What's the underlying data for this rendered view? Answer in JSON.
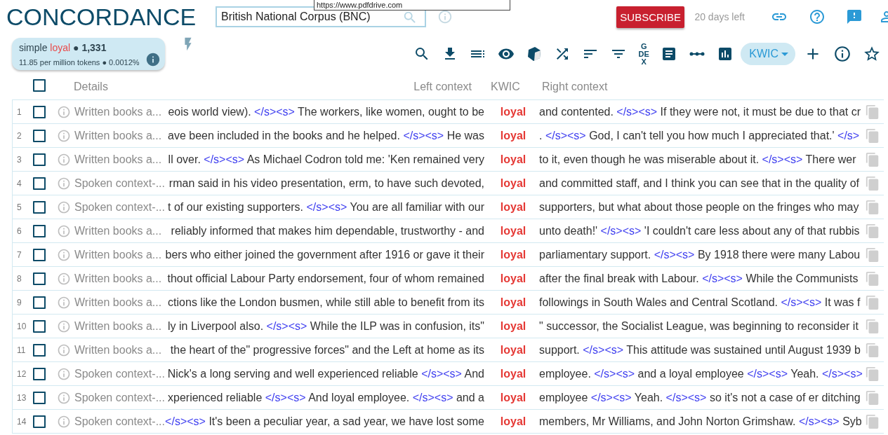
{
  "app": {
    "title": "CONCORDANCE",
    "corpus": "British National Corpus (BNC)",
    "subscribe": "SUBSCRIBE",
    "trial": "20 days left"
  },
  "tooltip": {
    "text": "https://www.pdfdrive.com"
  },
  "summary": {
    "line1": [
      {
        "kind": "text",
        "text": "simple "
      },
      {
        "kind": "query",
        "text": "loyal"
      },
      {
        "kind": "text",
        "text": " ● "
      },
      {
        "kind": "count",
        "text": "1,331"
      }
    ],
    "line2": "11.85 per million tokens ● 0.0012%"
  },
  "toolbar": {
    "gdex": "GDEX",
    "view_mode": "KWIC"
  },
  "table": {
    "select_all_checked": false,
    "columns": [
      "Details",
      "Left context",
      "KWIC",
      "Right context"
    ],
    "rows": [
      {
        "number": "1",
        "checked": false,
        "details": "Written books a...",
        "left": [
          {
            "text": "eois world view). ",
            "tag": "</s><s>"
          },
          {
            "text": " The workers, like women, ought to be"
          }
        ],
        "kwic": "loyal",
        "right": [
          {
            "text": "and contented. ",
            "tag": "</s><s>"
          },
          {
            "text": " If they were not, it must be due to that cr"
          }
        ]
      },
      {
        "number": "2",
        "checked": false,
        "details": "Written books a...",
        "left": [
          {
            "text": "ave been included in the books and he helped. ",
            "tag": "</s><s>"
          },
          {
            "text": " He was"
          }
        ],
        "kwic": "loyal",
        "right": [
          {
            "text": ". ",
            "tag": "</s><s>"
          },
          {
            "text": " God, I can't tell you how much I appreciated that.' ",
            "tag": "</s>"
          }
        ]
      },
      {
        "number": "3",
        "checked": false,
        "details": "Written books a...",
        "left": [
          {
            "text": "ll over. ",
            "tag": "</s><s>"
          },
          {
            "text": " As Michael Codron told me: 'Ken remained very"
          }
        ],
        "kwic": "loyal",
        "right": [
          {
            "text": "to it, even though he was miserable about it. ",
            "tag": "</s><s>"
          },
          {
            "text": " There wer"
          }
        ]
      },
      {
        "number": "4",
        "checked": false,
        "details": "Spoken context-...",
        "left": [
          {
            "text": "rman said in his video presentation, erm, to have such devoted,"
          }
        ],
        "kwic": "loyal",
        "right": [
          {
            "text": "and committed staff, and I think you can see that in the quality of"
          }
        ]
      },
      {
        "number": "5",
        "checked": false,
        "details": "Spoken context-...",
        "left": [
          {
            "text": "t of our existing supporters. ",
            "tag": "</s><s>"
          },
          {
            "text": " You are all familiar with our"
          }
        ],
        "kwic": "loyal",
        "right": [
          {
            "text": "supporters, but what about those people on the fringes who may"
          }
        ]
      },
      {
        "number": "6",
        "checked": false,
        "details": "Written books a...",
        "left": [
          {
            "text": "reliably informed that makes him dependable, trustworthy - and"
          }
        ],
        "kwic": "loyal",
        "right": [
          {
            "text": "unto death!' ",
            "tag": "</s><s>"
          },
          {
            "text": " 'I couldn't care less about any of that rubbis"
          }
        ]
      },
      {
        "number": "7",
        "checked": false,
        "details": "Written books a...",
        "left": [
          {
            "text": "bers who either joined the government after 1916 or gave it their"
          }
        ],
        "kwic": "loyal",
        "right": [
          {
            "text": "parliamentary support. ",
            "tag": "</s><s>"
          },
          {
            "text": " By 1918 there were many Labou"
          }
        ]
      },
      {
        "number": "8",
        "checked": false,
        "details": "Written books a...",
        "left": [
          {
            "text": "thout official Labour Party endorsement, four of whom remained"
          }
        ],
        "kwic": "loyal",
        "right": [
          {
            "text": "after the final break with Labour. ",
            "tag": "</s><s>"
          },
          {
            "text": " While the Communists"
          }
        ]
      },
      {
        "number": "9",
        "checked": false,
        "details": "Written books a...",
        "left": [
          {
            "text": "ctions like the London busmen, while still able to benefit from its"
          }
        ],
        "kwic": "loyal",
        "right": [
          {
            "text": "followings in South Wales and Central Scotland. ",
            "tag": "</s><s>"
          },
          {
            "text": " It was f"
          }
        ]
      },
      {
        "number": "10",
        "checked": false,
        "details": "Written books a...",
        "left": [
          {
            "text": "ly in Liverpool also. ",
            "tag": "</s><s>"
          },
          {
            "text": " While the ILP was in confusion, its\""
          }
        ],
        "kwic": "loyal",
        "right": [
          {
            "text": "\" successor, the Socialist League, was beginning to reconsider it"
          }
        ]
      },
      {
        "number": "11",
        "checked": false,
        "details": "Written books a...",
        "left": [
          {
            "text": "the heart of the\" progressive forces\" and the Left at home as its"
          }
        ],
        "kwic": "loyal",
        "right": [
          {
            "text": "support. ",
            "tag": "</s><s>"
          },
          {
            "text": " This attitude was sustained until August 1939 b"
          }
        ]
      },
      {
        "number": "12",
        "checked": false,
        "details": "Spoken context-...",
        "left": [
          {
            "text": "Nick's a long serving and well experienced reliable ",
            "tag": "</s><s>"
          },
          {
            "text": " And"
          }
        ],
        "kwic": "loyal",
        "right": [
          {
            "text": "employee. ",
            "tag": "</s><s>"
          },
          {
            "text": " and a loyal employee ",
            "tag": "</s><s>"
          },
          {
            "text": " Yeah. ",
            "tag": "</s><s>"
          }
        ]
      },
      {
        "number": "13",
        "checked": false,
        "details": "Spoken context-...",
        "left": [
          {
            "text": "xperienced reliable ",
            "tag": "</s><s>"
          },
          {
            "text": " And loyal employee. ",
            "tag": "</s><s>"
          },
          {
            "text": " and a"
          }
        ],
        "kwic": "loyal",
        "right": [
          {
            "text": "employee ",
            "tag": "</s><s>"
          },
          {
            "text": " Yeah. ",
            "tag": "</s><s>"
          },
          {
            "text": " so it's not a case of er ditching"
          }
        ]
      },
      {
        "number": "14",
        "checked": false,
        "details": "Spoken context-...",
        "left": [
          {
            "tag": "</s><s>"
          },
          {
            "text": " It's been a peculiar year, a sad year, we have lost some"
          }
        ],
        "kwic": "loyal",
        "right": [
          {
            "text": "members, Mr Williams, and John Norton Grimshaw. ",
            "tag": "</s><s>"
          },
          {
            "text": " Syb"
          }
        ]
      }
    ]
  }
}
